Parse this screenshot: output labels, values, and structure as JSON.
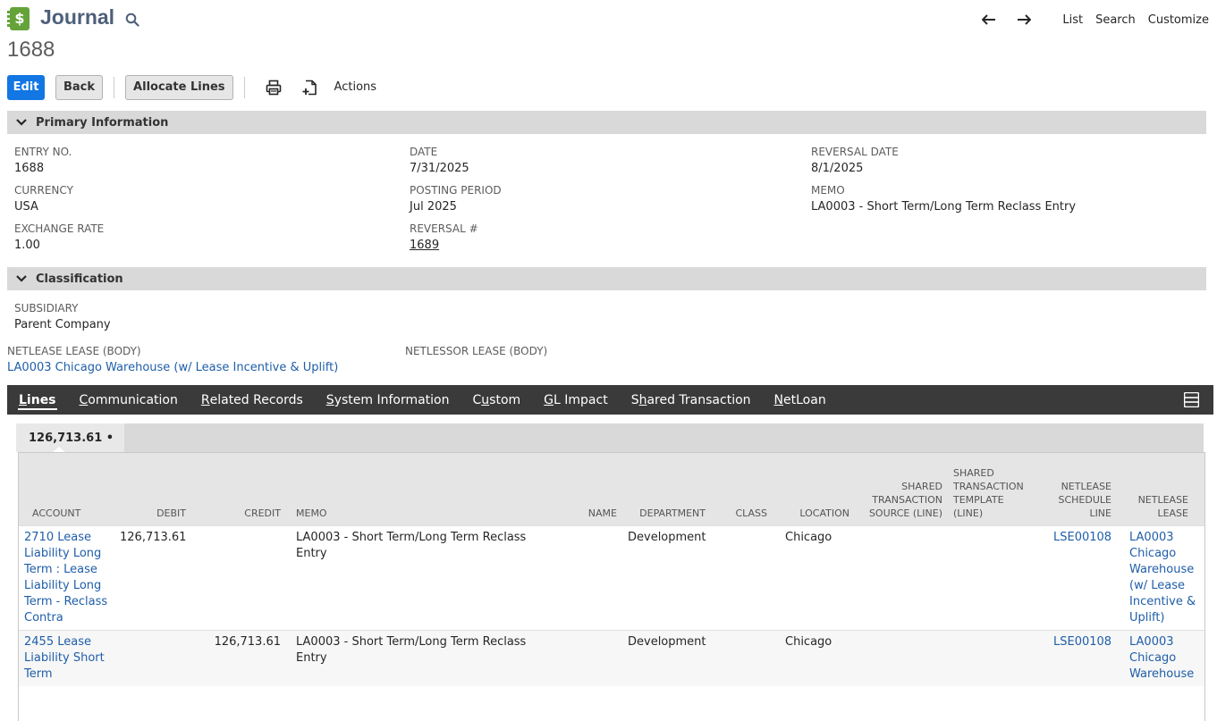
{
  "header": {
    "page_type": "Journal",
    "record_number": "1688",
    "nav": {
      "list": "List",
      "search": "Search",
      "customize": "Customize"
    }
  },
  "buttons": {
    "edit": "Edit",
    "back": "Back",
    "allocate_lines": "Allocate Lines",
    "actions": "Actions"
  },
  "primary": {
    "title": "Primary Information",
    "entry_no_label": "ENTRY NO.",
    "entry_no": "1688",
    "currency_label": "CURRENCY",
    "currency": "USA",
    "exchange_rate_label": "EXCHANGE RATE",
    "exchange_rate": "1.00",
    "date_label": "DATE",
    "date": "7/31/2025",
    "posting_period_label": "POSTING PERIOD",
    "posting_period": "Jul 2025",
    "reversal_no_label": "REVERSAL #",
    "reversal_no": "1689",
    "reversal_date_label": "REVERSAL DATE",
    "reversal_date": "8/1/2025",
    "memo_label": "MEMO",
    "memo": "LA0003 - Short Term/Long Term Reclass Entry"
  },
  "classification": {
    "title": "Classification",
    "subsidiary_label": "SUBSIDIARY",
    "subsidiary": "Parent Company",
    "netlease_label": "NETLEASE LEASE (BODY)",
    "netlease": "LA0003 Chicago Warehouse (w/ Lease Incentive & Uplift)",
    "netlessor_label": "NETLESSOR LEASE (BODY)"
  },
  "tabs": [
    {
      "pre": "",
      "ul": "L",
      "post": "ines"
    },
    {
      "pre": "",
      "ul": "C",
      "post": "ommunication"
    },
    {
      "pre": "",
      "ul": "R",
      "post": "elated Records"
    },
    {
      "pre": "",
      "ul": "S",
      "post": "ystem Information"
    },
    {
      "pre": "C",
      "ul": "u",
      "post": "stom"
    },
    {
      "pre": "",
      "ul": "G",
      "post": "L Impact"
    },
    {
      "pre": "S",
      "ul": "h",
      "post": "ared Transaction"
    },
    {
      "pre": "",
      "ul": "N",
      "post": "etLoan"
    }
  ],
  "lines": {
    "subtab_label": "126,713.61 •",
    "columns": {
      "account": "ACCOUNT",
      "debit": "DEBIT",
      "credit": "CREDIT",
      "memo": "MEMO",
      "name": "NAME",
      "department": "DEPARTMENT",
      "class": "CLASS",
      "location": "LOCATION",
      "shared_source": "SHARED TRANSACTION SOURCE (LINE)",
      "shared_template": "SHARED TRANSACTION TEMPLATE (LINE)",
      "schedule_line": "NETLEASE SCHEDULE LINE",
      "netlease_lease": "NETLEASE LEASE"
    },
    "rows": [
      {
        "account": "2710 Lease Liability Long Term : Lease Liability Long Term - Reclass Contra",
        "debit": "126,713.61",
        "credit": "",
        "memo": "LA0003 - Short Term/Long Term Reclass Entry",
        "name": "",
        "department": "Development",
        "class": "",
        "location": "Chicago",
        "shared_source": "",
        "shared_template": "",
        "schedule_line": "LSE00108",
        "netlease_lease": "LA0003 Chicago Warehouse (w/ Lease Incentive & Uplift)"
      },
      {
        "account": "2455 Lease Liability Short Term",
        "debit": "",
        "credit": "126,713.61",
        "memo": "LA0003 - Short Term/Long Term Reclass Entry",
        "name": "",
        "department": "Development",
        "class": "",
        "location": "Chicago",
        "shared_source": "",
        "shared_template": "",
        "schedule_line": "LSE00108",
        "netlease_lease": "LA0003 Chicago Warehouse"
      }
    ]
  }
}
